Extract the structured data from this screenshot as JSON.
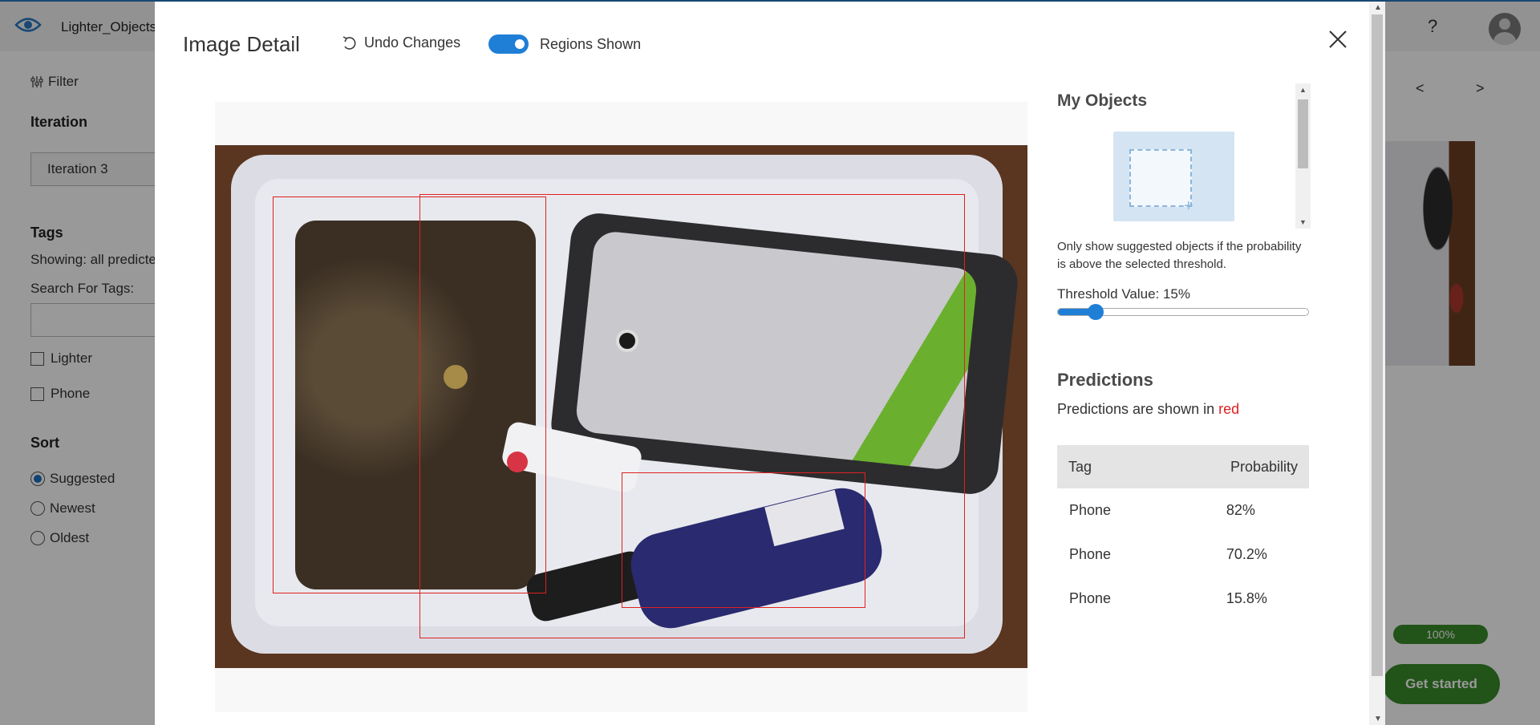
{
  "app": {
    "project_name": "Lighter_Objects",
    "sidebar": {
      "filter_label": "Filter",
      "iteration_heading": "Iteration",
      "iteration_value": "Iteration 3",
      "tags_heading": "Tags",
      "showing_text": "Showing: all predicted",
      "search_label": "Search For Tags:",
      "tags": [
        "Lighter",
        "Phone"
      ],
      "sort_heading": "Sort",
      "sort_options": [
        "Suggested",
        "Newest",
        "Oldest"
      ],
      "sort_selected": "Suggested"
    },
    "pager": {
      "prev": "<",
      "next": ">"
    },
    "progress_badge": "100%",
    "get_started": "Get started"
  },
  "modal": {
    "title": "Image Detail",
    "undo_label": "Undo Changes",
    "regions_label": "Regions Shown",
    "regions_on": true,
    "my_objects_heading": "My Objects",
    "threshold_hint": "Only show suggested objects if the probability is above the selected threshold.",
    "threshold_label": "Threshold Value: 15%",
    "threshold_value": 0.15,
    "predictions_heading": "Predictions",
    "predictions_sub_prefix": "Predictions are shown in ",
    "predictions_sub_color_word": "red",
    "table_headers": {
      "tag": "Tag",
      "probability": "Probability"
    },
    "predictions": [
      {
        "tag": "Phone",
        "probability": "82%"
      },
      {
        "tag": "Phone",
        "probability": "70.2%"
      },
      {
        "tag": "Phone",
        "probability": "15.8%"
      }
    ],
    "region_color": "#e02020",
    "accent_color": "#1f7fd6"
  }
}
